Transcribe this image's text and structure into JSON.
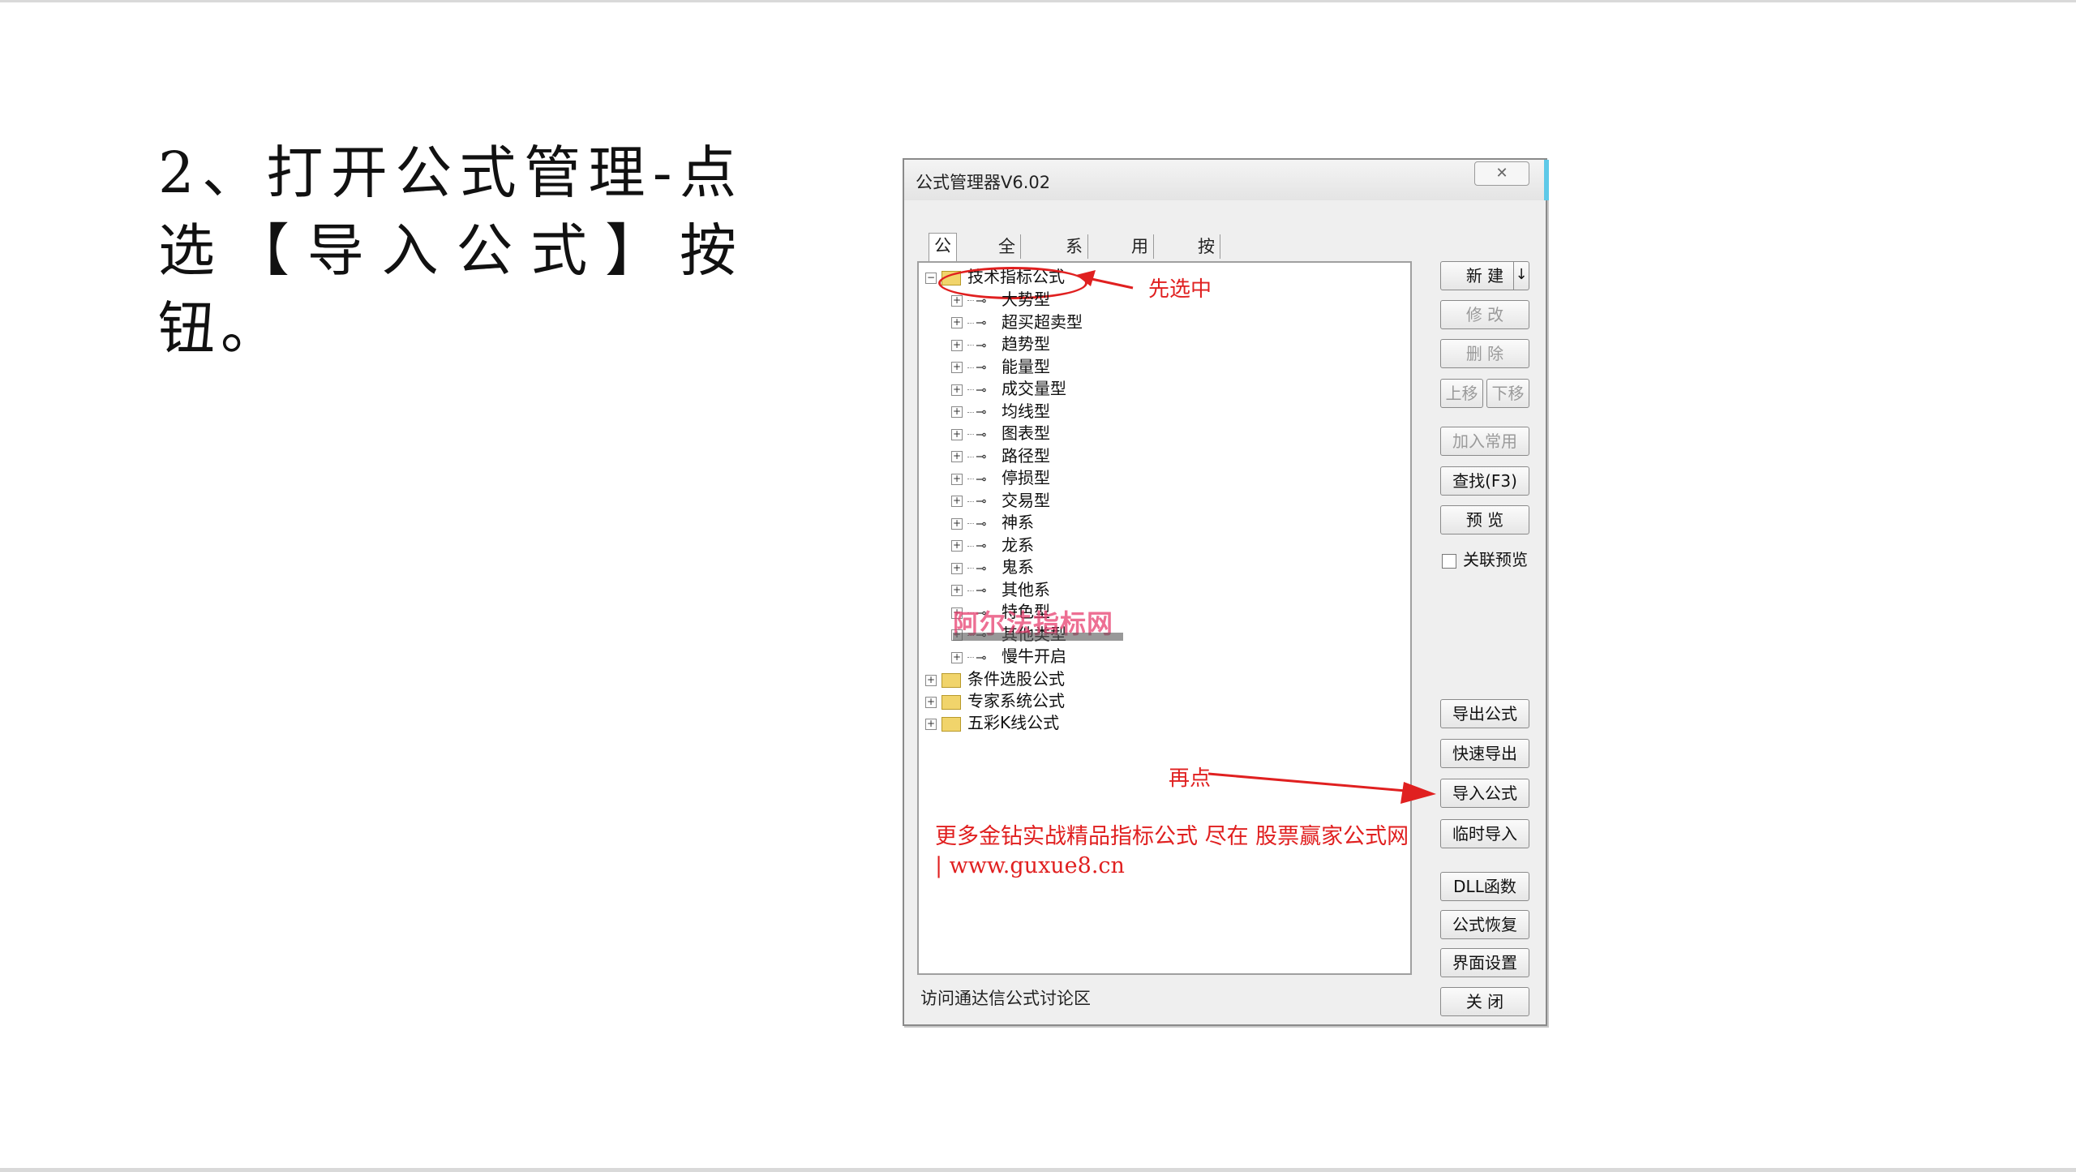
{
  "instruction_text": "2、打开公式管理-点选【导入公式】按钮。",
  "window": {
    "title": "公式管理器V6.02",
    "close_glyph": "✕",
    "tabs": [
      "公式组",
      "全部",
      "系统",
      "用户",
      "按日期频度"
    ],
    "status": "访问通达信公式讨论区"
  },
  "tree": {
    "root": "技术指标公式",
    "children": [
      "大势型",
      "超买超卖型",
      "趋势型",
      "能量型",
      "成交量型",
      "均线型",
      "图表型",
      "路径型",
      "停损型",
      "交易型",
      "神系",
      "龙系",
      "鬼系",
      "其他系",
      "特色型",
      "其他类型",
      "慢牛开启"
    ],
    "folders": [
      "条件选股公式",
      "专家系统公式",
      "五彩K线公式"
    ]
  },
  "annotations": {
    "select_first": "先选中",
    "then_click": "再点",
    "watermark": "阿尔法指标网",
    "promo": "更多金钻实战精品指标公式 尽在 股票赢家公式网 | www.guxue8.cn"
  },
  "buttons": {
    "new": "新  建",
    "new_arrow": "↓",
    "modify": "修  改",
    "delete": "删  除",
    "move_up": "上移",
    "move_down": "下移",
    "add_common": "加入常用",
    "find": "查找(F3)",
    "preview": "预  览",
    "link_preview": "关联预览",
    "export": "导出公式",
    "quick_export": "快速导出",
    "import": "导入公式",
    "temp_import": "临时导入",
    "dll": "DLL函数",
    "restore": "公式恢复",
    "ui_settings": "界面设置",
    "close": "关  闭"
  },
  "colors": {
    "annotation": "#e02020",
    "watermark": "#e83f6f",
    "folder": "#f1d46b"
  },
  "icons": {
    "folder": "folder-icon",
    "formula": "key-icon",
    "expand": "plus-box-icon",
    "collapse": "minus-box-icon",
    "arrow": "red-arrow-icon"
  }
}
